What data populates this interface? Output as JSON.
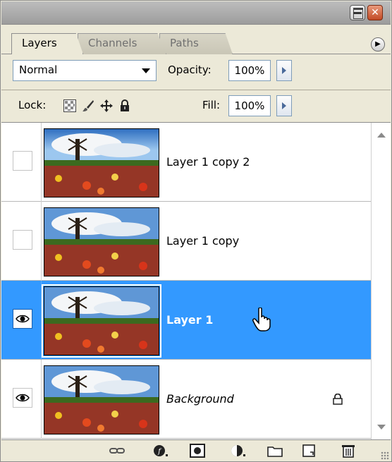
{
  "panel": {
    "tabs": [
      {
        "label": "Layers",
        "active": true
      },
      {
        "label": "Channels",
        "active": false
      },
      {
        "label": "Paths",
        "active": false
      }
    ],
    "blend_mode": "Normal",
    "opacity_label": "Opacity:",
    "opacity_value": "100%",
    "lock_label": "Lock:",
    "fill_label": "Fill:",
    "fill_value": "100%",
    "layers": [
      {
        "name": "Layer 1 copy 2",
        "visible": false,
        "selected": false,
        "locked": false
      },
      {
        "name": "Layer 1 copy",
        "visible": false,
        "selected": false,
        "locked": false
      },
      {
        "name": "Layer 1",
        "visible": true,
        "selected": true,
        "locked": false
      },
      {
        "name": "Background",
        "visible": true,
        "selected": false,
        "locked": true
      }
    ]
  },
  "colors": {
    "selection": "#3399ff",
    "panel_bg": "#ece9d8",
    "title_bg": "#a9a9a9"
  },
  "icons": {
    "lock_transparent": "checker-icon",
    "lock_image": "brush-icon",
    "lock_position": "move-icon",
    "lock_all": "lock-icon",
    "footer": [
      "link-layers-icon",
      "layer-style-icon",
      "layer-mask-icon",
      "adjustment-layer-icon",
      "new-group-icon",
      "new-layer-icon",
      "trash-icon"
    ]
  }
}
